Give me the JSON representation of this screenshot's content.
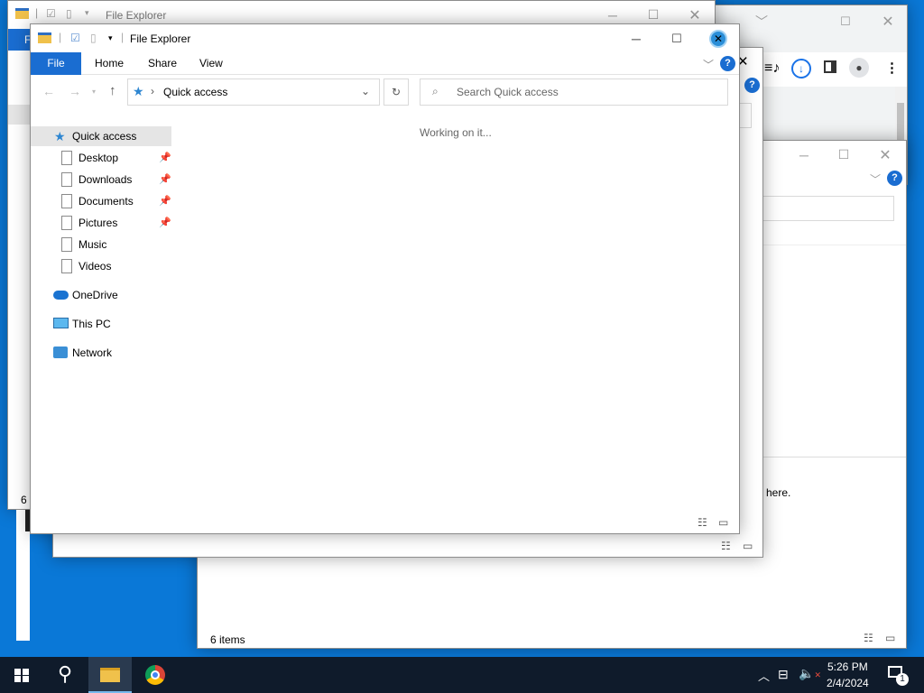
{
  "back_window_left": {
    "title": "File Explorer",
    "status_text": "6 i",
    "ribbon_file": "F"
  },
  "back_window_right": {
    "status_text": "6 items",
    "content_fragment": "here."
  },
  "main_explorer": {
    "title": "File Explorer",
    "ribbon_tabs": [
      "File",
      "Home",
      "Share",
      "View"
    ],
    "address": "Quick access",
    "search_placeholder": "Search Quick access",
    "status_message": "Working on it...",
    "nav": {
      "quick_access": "Quick access",
      "pinned": [
        "Desktop",
        "Downloads",
        "Documents",
        "Pictures"
      ],
      "unpinned": [
        "Music",
        "Videos"
      ],
      "onedrive": "OneDrive",
      "this_pc": "This PC",
      "network": "Network"
    }
  },
  "taskbar": {
    "time": "5:26 PM",
    "date": "2/4/2024",
    "notification_count": "1"
  },
  "colors": {
    "desktop": "#0a78d7",
    "taskbar": "#0f1b2b",
    "accent": "#1a6dd1",
    "selection": "#e5e5e5"
  },
  "icons": [
    "folder-icon",
    "search-icon",
    "chrome-icon",
    "windows-start-icon",
    "onedrive-icon",
    "network-icon",
    "pc-icon",
    "star-icon"
  ]
}
